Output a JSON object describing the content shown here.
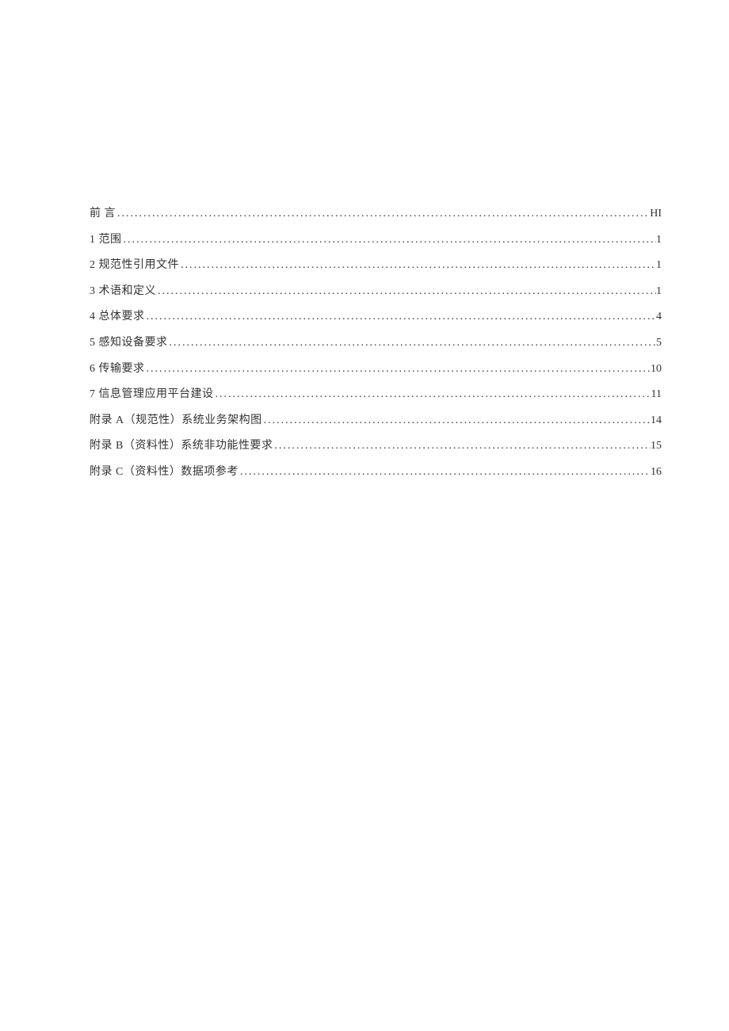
{
  "toc": {
    "entries": [
      {
        "label": "前 言",
        "page": "HI"
      },
      {
        "label": "1 范围",
        "page": "1"
      },
      {
        "label": "2 规范性引用文件",
        "page": "1"
      },
      {
        "label": "3 术语和定义",
        "page": "1"
      },
      {
        "label": "4 总体要求",
        "page": "4"
      },
      {
        "label": "5 感知设备要求",
        "page": "5"
      },
      {
        "label": "6 传输要求",
        "page": "10"
      },
      {
        "label": "7 信息管理应用平台建设",
        "page": "11"
      },
      {
        "label": "附录 A（规范性）系统业务架构图",
        "page": "14"
      },
      {
        "label": "附录 B（资料性）系统非功能性要求",
        "page": "15"
      },
      {
        "label": "附录 C（资料性）数据项参考",
        "page": "16"
      }
    ]
  }
}
